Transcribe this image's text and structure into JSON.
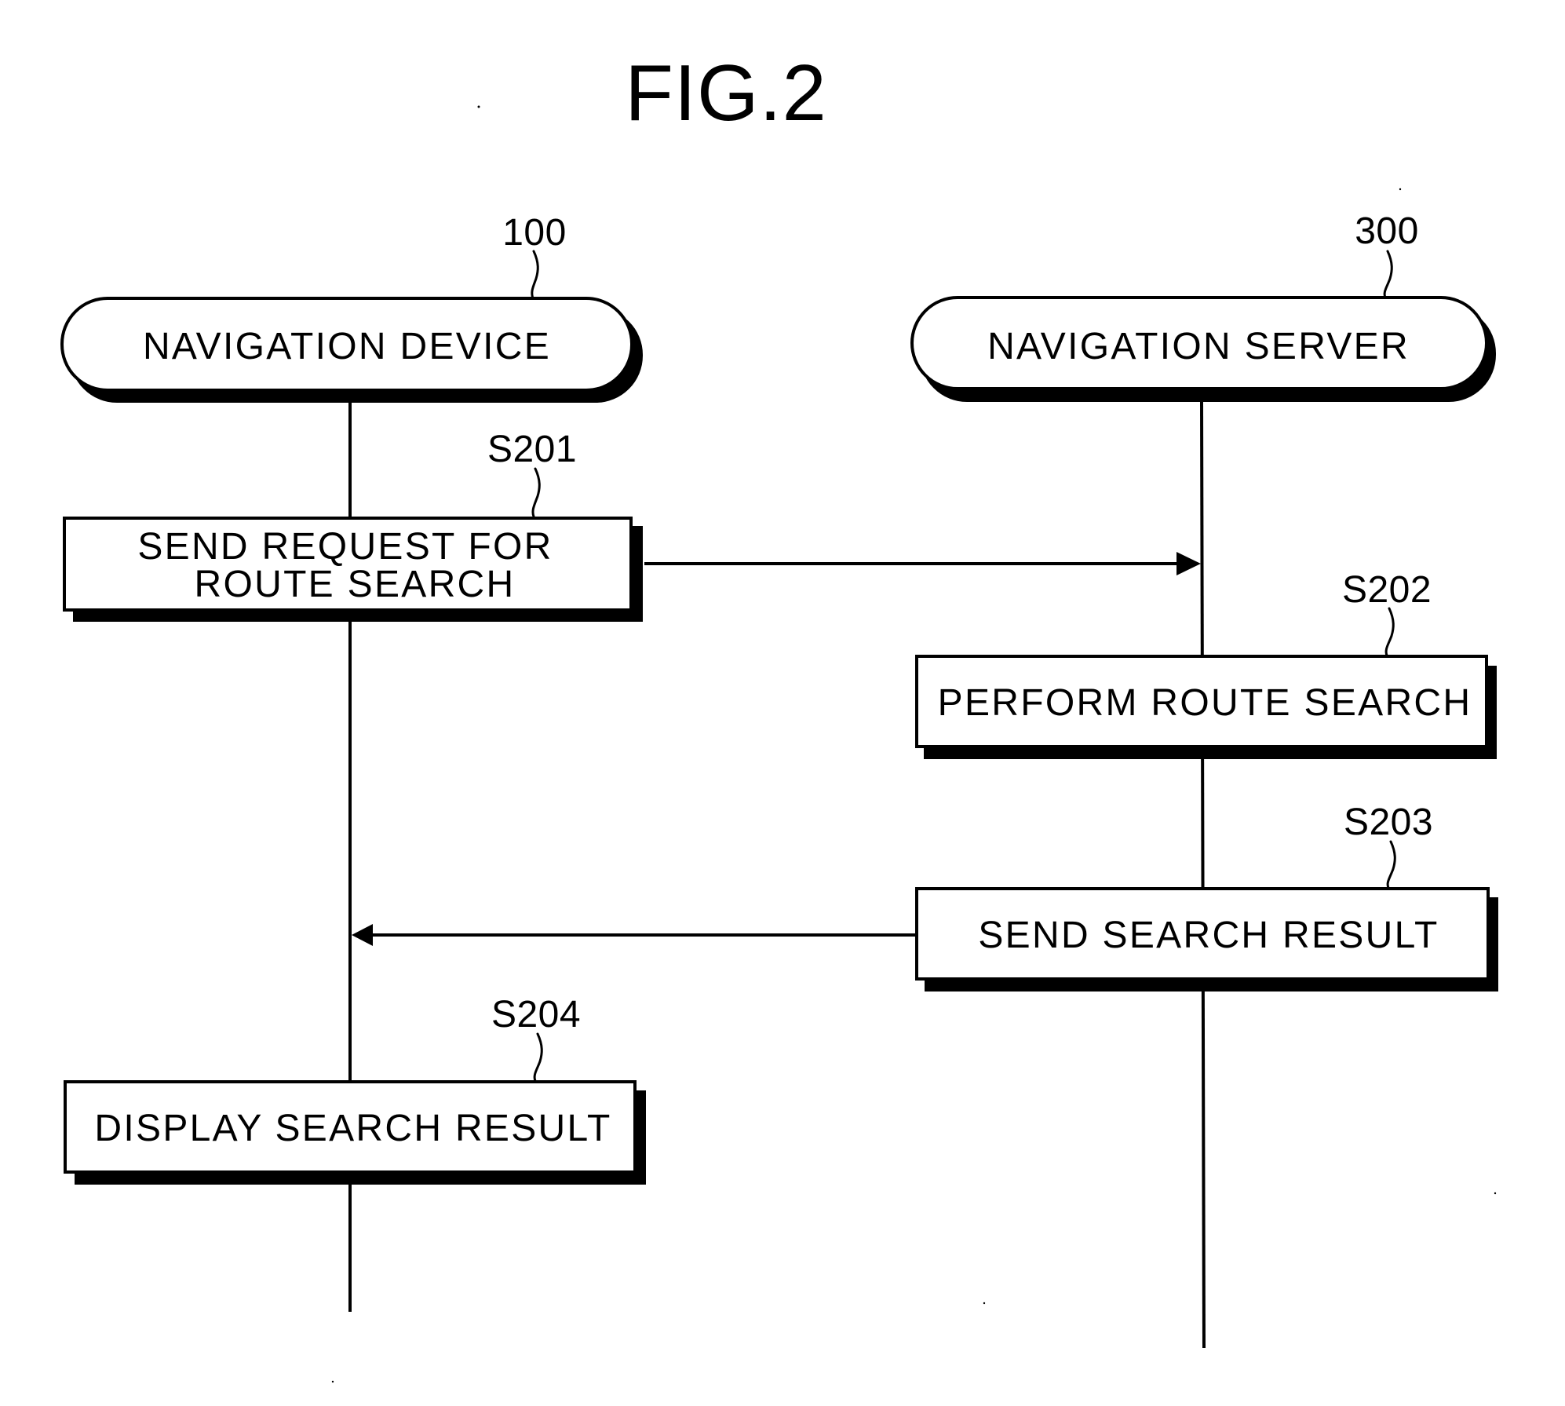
{
  "figure": {
    "title": "FIG.2",
    "diagram_type": "sequence-flow",
    "actors": [
      {
        "ref": "100",
        "label": "NAVIGATION DEVICE"
      },
      {
        "ref": "300",
        "label": "NAVIGATION SERVER"
      }
    ],
    "steps": [
      {
        "ref": "S201",
        "actor": "NAVIGATION DEVICE",
        "lines": [
          "SEND REQUEST FOR",
          "ROUTE SEARCH"
        ]
      },
      {
        "ref": "S202",
        "actor": "NAVIGATION SERVER",
        "lines": [
          "PERFORM ROUTE SEARCH"
        ]
      },
      {
        "ref": "S203",
        "actor": "NAVIGATION SERVER",
        "lines": [
          "SEND SEARCH RESULT"
        ]
      },
      {
        "ref": "S204",
        "actor": "NAVIGATION DEVICE",
        "lines": [
          "DISPLAY SEARCH RESULT"
        ]
      }
    ],
    "messages": [
      {
        "from": "S201",
        "to": "NAVIGATION SERVER",
        "direction": "right"
      },
      {
        "from": "S203",
        "to": "NAVIGATION DEVICE",
        "direction": "left"
      }
    ],
    "colors": {
      "ink": "#000000",
      "paper": "#ffffff"
    }
  }
}
